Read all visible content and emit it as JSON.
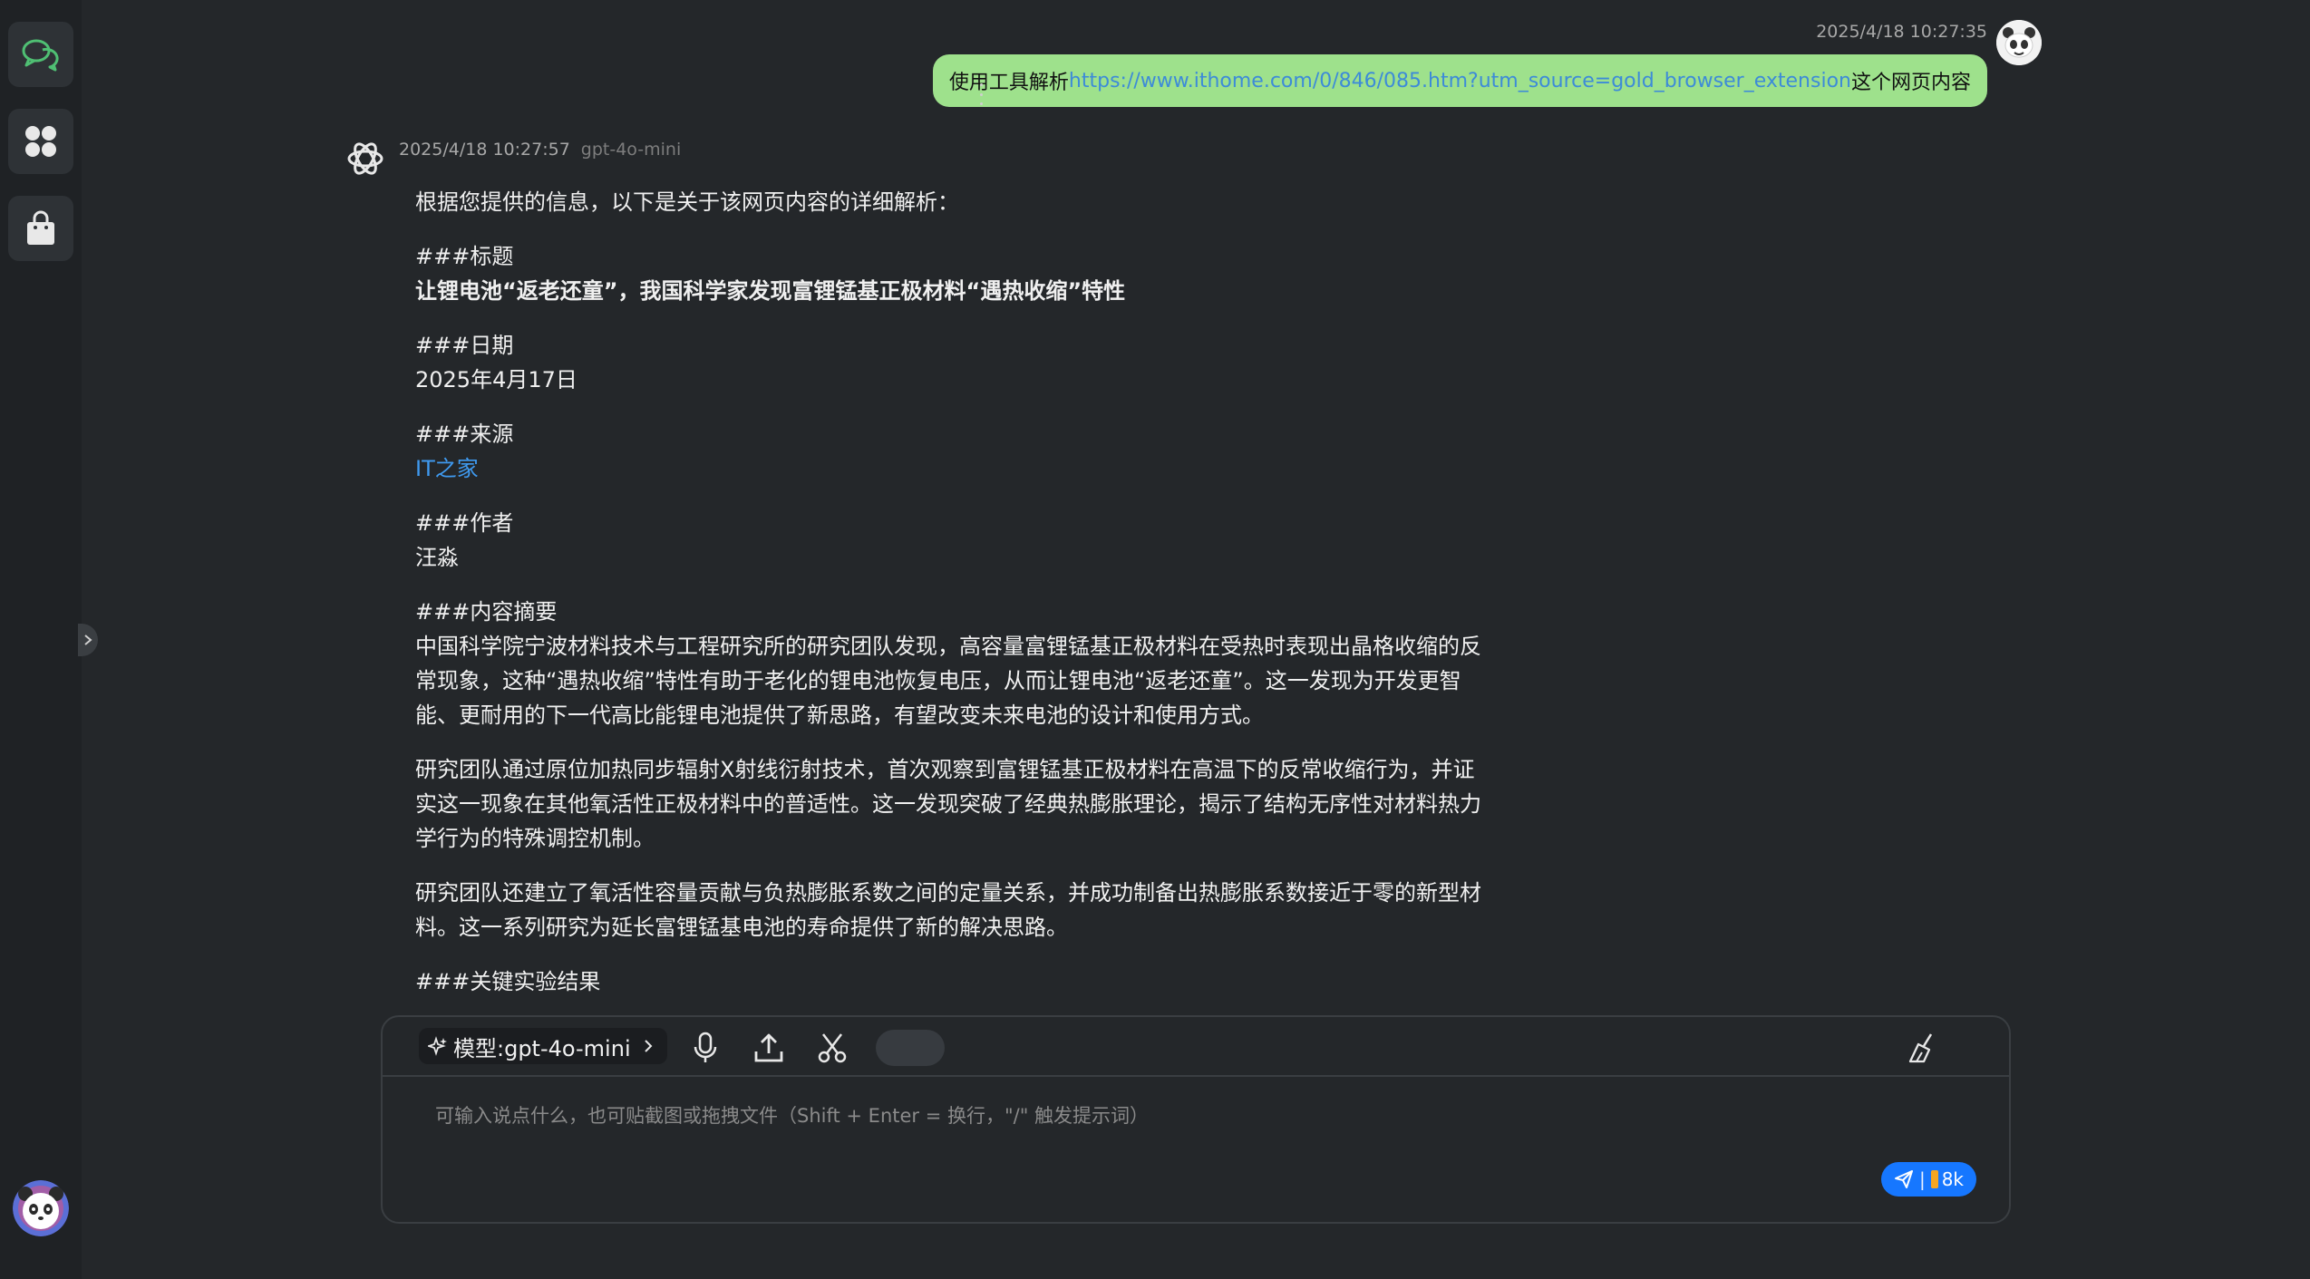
{
  "sidebar": {
    "items": [
      {
        "name": "chat",
        "icon": "chat-bubbles-icon",
        "color": "#4fbf73"
      },
      {
        "name": "apps",
        "icon": "apps-grid-icon"
      },
      {
        "name": "store",
        "icon": "shopping-bag-icon"
      }
    ],
    "expand_icon": "chevron-right-icon"
  },
  "user_message": {
    "timestamp": "2025/4/18 10:27:35",
    "text_before": "使用工具解析",
    "link": "https://www.ithome.com/0/846/085.htm?utm_source=gold_browser_extension",
    "text_after": " 这个网页内容",
    "bubble_color": "#9ee18c"
  },
  "bot_message": {
    "timestamp": "2025/4/18 10:27:57",
    "model": "gpt-4o-mini",
    "intro": "根据您提供的信息，以下是关于该网页内容的详细解析：",
    "title_heading": "###标题",
    "title_text": "让锂电池“返老还童”，我国科学家发现富锂锰基正极材料“遇热收缩”特性",
    "date_heading": "###日期",
    "date_text": "2025年4月17日",
    "source_heading": "###来源",
    "source_link": "IT之家",
    "author_heading": "###作者",
    "author_text": "汪淼",
    "summary_heading": "###内容摘要",
    "summary_p1": "中国科学院宁波材料技术与工程研究所的研究团队发现，高容量富锂锰基正极材料在受热时表现出晶格收缩的反常现象，这种“遇热收缩”特性有助于老化的锂电池恢复电压，从而让锂电池“返老还童”。这一发现为开发更智能、更耐用的下一代高比能锂电池提供了新思路，有望改变未来电池的设计和使用方式。",
    "summary_p2": "研究团队通过原位加热同步辐射X射线衍射技术，首次观察到富锂锰基正极材料在高温下的反常收缩行为，并证实这一现象在其他氧活性正极材料中的普适性。这一发现突破了经典热膨胀理论，揭示了结构无序性对材料热力学行为的特殊调控机制。",
    "summary_p3": "研究团队还建立了氧活性容量贡献与负热膨胀系数之间的定量关系，并成功制备出热膨胀系数接近于零的新型材料。这一系列研究为延长富锂锰基电池的寿命提供了新的解决思路。",
    "results_heading": "###关键实验结果"
  },
  "composer": {
    "model_label": "模型:gpt-4o-mini",
    "placeholder": "可输入说点什么，也可贴截图或拖拽文件（Shift + Enter = 换行，\"/\" 触发提示词）",
    "value": "",
    "send_sep": "|",
    "token_count": "8k",
    "accent_color": "#1677ff"
  }
}
